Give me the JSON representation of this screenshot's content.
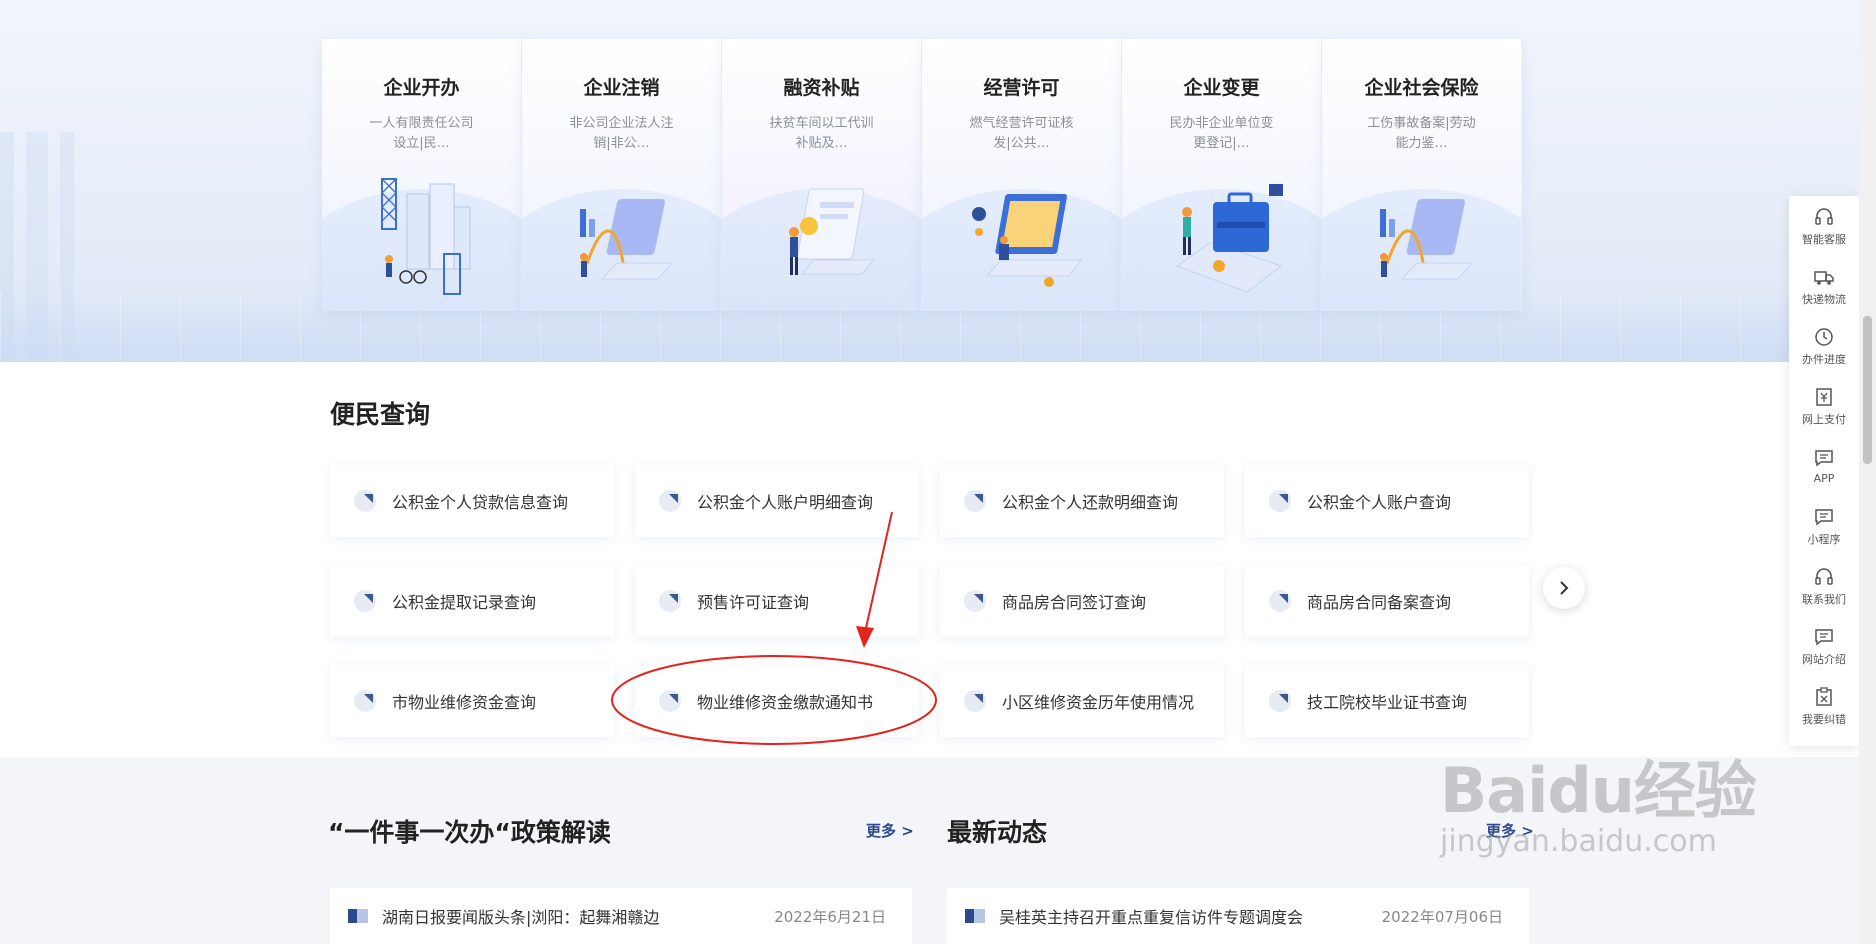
{
  "services": [
    {
      "title": "企业开办",
      "desc": "一人有限责任公司设立|民…"
    },
    {
      "title": "企业注销",
      "desc": "非公司企业法人注销|非公…"
    },
    {
      "title": "融资补贴",
      "desc": "扶贫车间以工代训补贴及…"
    },
    {
      "title": "经营许可",
      "desc": "燃气经营许可证核发|公共…"
    },
    {
      "title": "企业变更",
      "desc": "民办非企业单位变更登记|…"
    },
    {
      "title": "企业社会保险",
      "desc": "工伤事故备案|劳动能力鉴…"
    }
  ],
  "convenience": {
    "title": "便民查询",
    "items": [
      "公积金个人贷款信息查询",
      "公积金个人账户明细查询",
      "公积金个人还款明细查询",
      "公积金个人账户查询",
      "公积金提取记录查询",
      "预售许可证查询",
      "商品房合同签订查询",
      "商品房合同备案查询",
      "市物业维修资金查询",
      "物业维修资金缴款通知书",
      "小区维修资金历年使用情况",
      "技工院校毕业证书查询"
    ],
    "next_icon": "chevron-right-icon"
  },
  "policy": {
    "title": "“一件事一次办“政策解读",
    "more": "更多 >",
    "items": [
      {
        "text": "湖南日报要闻版头条|浏阳：起舞湘赣边",
        "date": "2022年6月21日"
      }
    ]
  },
  "news": {
    "title": "最新动态",
    "more": "更多 >",
    "items": [
      {
        "text": "吴桂英主持召开重点重复信访件专题调度会",
        "date": "2022年07月06日"
      }
    ]
  },
  "sidebar": {
    "items": [
      {
        "label": "智能客服",
        "icon": "headset-icon"
      },
      {
        "label": "快递物流",
        "icon": "truck-icon"
      },
      {
        "label": "办件进度",
        "icon": "clock-icon"
      },
      {
        "label": "网上支付",
        "icon": "yuan-icon"
      },
      {
        "label": "APP",
        "icon": "message-icon"
      },
      {
        "label": "小程序",
        "icon": "message-icon"
      },
      {
        "label": "联系我们",
        "icon": "headset-icon"
      },
      {
        "label": "网站介绍",
        "icon": "message-icon"
      },
      {
        "label": "我要纠错",
        "icon": "clipboard-icon"
      }
    ]
  },
  "watermark": {
    "main": "Baidu经验",
    "sub": "jingyan.baidu.com"
  },
  "colors": {
    "accent": "#2c4a8a",
    "annotation": "#e3231c"
  }
}
